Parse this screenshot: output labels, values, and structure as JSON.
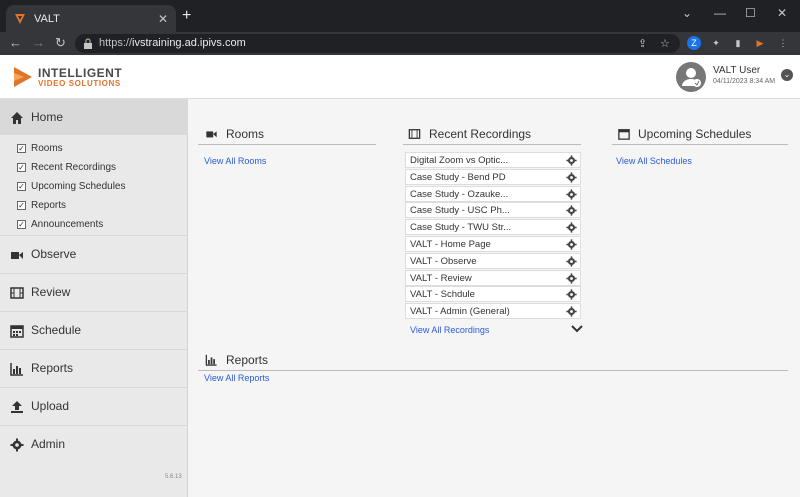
{
  "browser": {
    "tab_title": "VALT",
    "tab_close": "✕",
    "new_tab": "+",
    "url_scheme": "https://",
    "url_host": "ivstraining.ad.ipivs.com",
    "window_controls": [
      "⌄",
      "—",
      "☐",
      "✕"
    ]
  },
  "header": {
    "logo_line1": "INTELLIGENT",
    "logo_line2": "VIDEO SOLUTIONS",
    "user_name": "VALT User",
    "user_date": "04/11/2023 8:34 AM"
  },
  "sidebar": {
    "items": [
      {
        "label": "Home",
        "icon": "home-icon"
      },
      {
        "label": "Observe",
        "icon": "video-camera-icon"
      },
      {
        "label": "Review",
        "icon": "film-icon"
      },
      {
        "label": "Schedule",
        "icon": "calendar-icon"
      },
      {
        "label": "Reports",
        "icon": "bar-chart-icon"
      },
      {
        "label": "Upload",
        "icon": "upload-icon"
      },
      {
        "label": "Admin",
        "icon": "gear-icon"
      }
    ],
    "home_sub": [
      "Rooms",
      "Recent Recordings",
      "Upcoming Schedules",
      "Reports",
      "Announcements"
    ],
    "version": "5.6.13"
  },
  "widgets": {
    "rooms": {
      "title": "Rooms",
      "link": "View All Rooms"
    },
    "recordings": {
      "title": "Recent Recordings",
      "items": [
        "Digital Zoom vs Optic...",
        "Case Study - Bend PD",
        "Case Study - Ozauke...",
        "Case Study - USC Ph...",
        "Case Study - TWU Str...",
        "VALT - Home Page",
        "VALT - Observe",
        "VALT - Review",
        "VALT - Schdule",
        "VALT - Admin (General)"
      ],
      "link": "View All Recordings"
    },
    "schedules": {
      "title": "Upcoming Schedules",
      "link": "View All Schedules"
    },
    "reports": {
      "title": "Reports",
      "link": "View All Reports"
    }
  },
  "colors": {
    "accent_orange": "#e0742a",
    "link_blue": "#2a5bd7"
  }
}
